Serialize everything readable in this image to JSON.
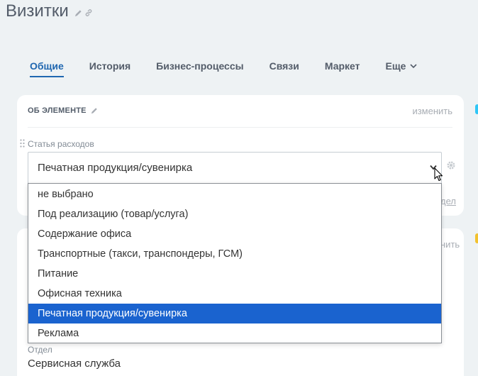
{
  "page": {
    "title": "Визитки"
  },
  "tabs": [
    {
      "label": "Общие",
      "active": true
    },
    {
      "label": "История"
    },
    {
      "label": "Бизнес-процессы"
    },
    {
      "label": "Связи"
    },
    {
      "label": "Маркет"
    },
    {
      "label": "Еще"
    }
  ],
  "card": {
    "header": "ОБ ЭЛЕМЕНТЕ",
    "edit_link": "изменить"
  },
  "field": {
    "label": "Статья расходов",
    "value": "Печатная продукция/сувенирка"
  },
  "dropdown": {
    "options": [
      "не выбрано",
      "Под реализацию (товар/услуга)",
      "Содержание офиса",
      "Транспортные (такси, транспондеры, ГСМ)",
      "Питание",
      "Офисная техника",
      "Печатная продукция/сувенирка",
      "Реклама"
    ],
    "selected_index": 6
  },
  "behind": {
    "link1": "дел",
    "link2": "нить"
  },
  "department": {
    "label": "Отдел",
    "value": "Сервисная служба"
  },
  "colors": {
    "accent": "#2067b0",
    "selected_bg": "#1a63cf",
    "background": "#eef2f4"
  }
}
